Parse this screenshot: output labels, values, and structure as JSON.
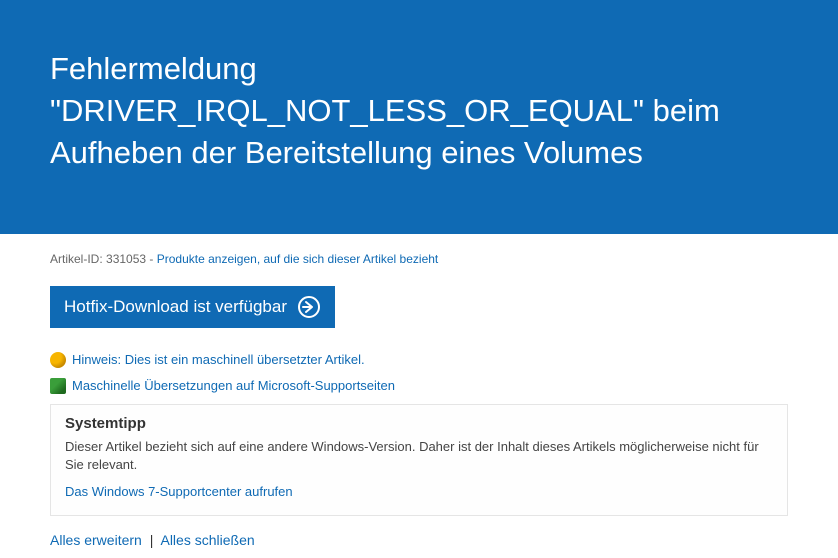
{
  "hero": {
    "title": "Fehlermeldung \"DRIVER_IRQL_NOT_LESS_OR_EQUAL\" beim Aufheben der Bereitstellung eines Volumes"
  },
  "article": {
    "id_label": "Artikel-ID:",
    "id_value": "331053",
    "dash": " - ",
    "products_link": "Produkte anzeigen, auf die sich dieser Artikel bezieht"
  },
  "hotfix": {
    "label": "Hotfix-Download ist verfügbar"
  },
  "notes": {
    "machine_hint": "Hinweis: Dies ist ein maschinell übersetzter Artikel.",
    "translation_link": "Maschinelle Übersetzungen auf Microsoft-Supportseiten"
  },
  "tip": {
    "heading": "Systemtipp",
    "body": "Dieser Artikel bezieht sich auf eine andere Windows-Version. Daher ist der Inhalt dieses Artikels möglicherweise nicht für Sie relevant.",
    "link": "Das Windows 7-Supportcenter aufrufen"
  },
  "expand": {
    "expand_all": "Alles erweitern",
    "collapse_all": "Alles schließen",
    "separator": "|"
  }
}
